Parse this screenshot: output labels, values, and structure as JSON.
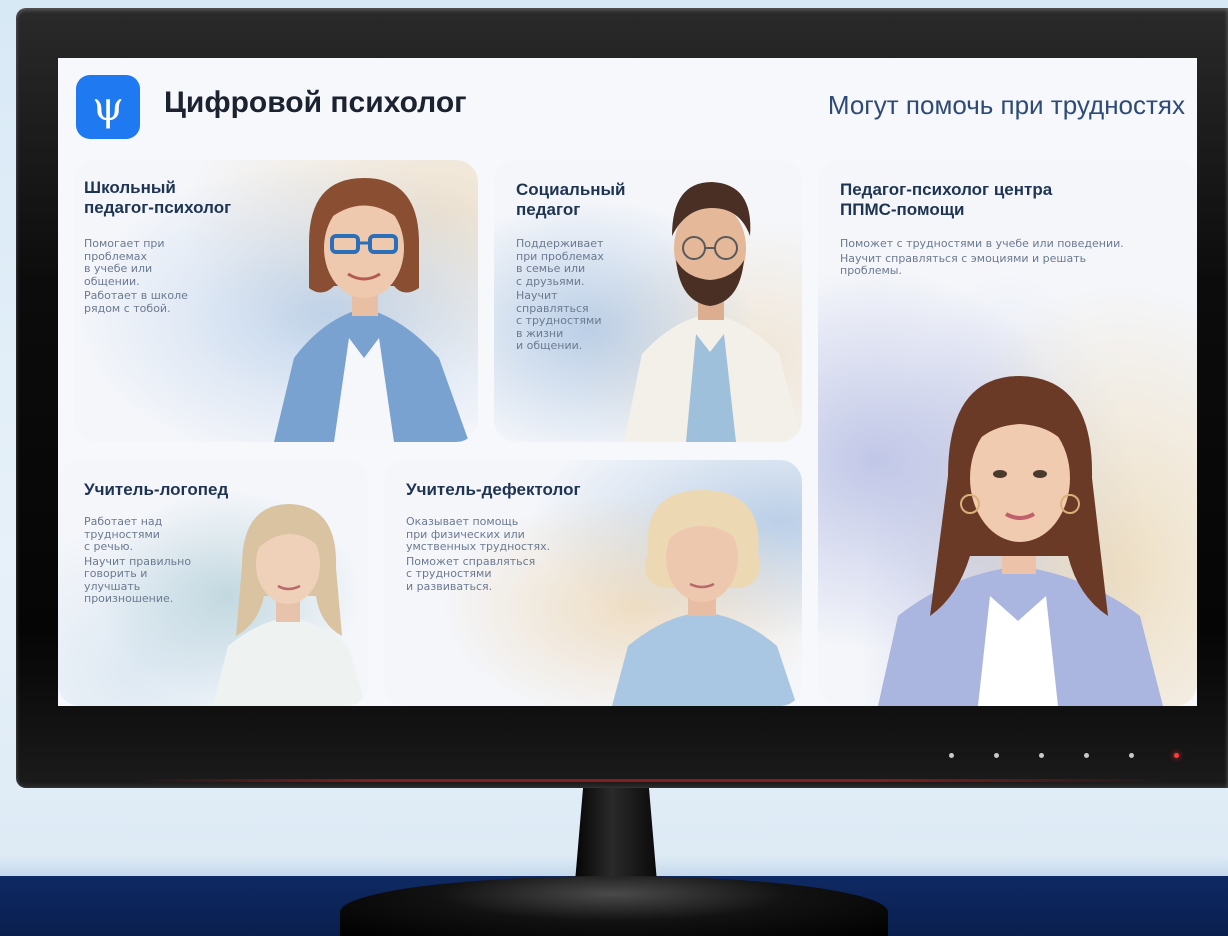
{
  "app": {
    "title": "Цифровой психолог",
    "subtitle": "Могут помочь при трудностях",
    "logo_icon": "psi-icon",
    "accent_color": "#1f79f0"
  },
  "cards": [
    {
      "title": "Школьный\nпедагог-психолог",
      "paragraphs": [
        "Помогает при\nпроблемах\nв учебе или\nобщении.",
        "Работает в школе\nрядом с тобой."
      ]
    },
    {
      "title": "Социальный\nпедагог",
      "paragraphs": [
        "Поддерживает\nпри проблемах\nв семье или\nс друзьями.",
        "Научит\nсправляться\nс трудностями\nв жизни\nи общении."
      ]
    },
    {
      "title": "Педагог-психолог центра\nППМС-помощи",
      "paragraphs": [
        "Поможет с трудностями в учебе или поведении.",
        "Научит справляться с эмоциями и решать\nпроблемы."
      ]
    },
    {
      "title": "Учитель-логопед",
      "paragraphs": [
        "Работает над\nтрудностями\nс речью.",
        "Научит правильно\nговорить и\nулучшать\nпроизношение."
      ]
    },
    {
      "title": "Учитель-дефектолог",
      "paragraphs": [
        "Оказывает помощь\nпри физических или\nумственных трудностях.",
        "Поможет справляться\nс трудностями\nи развиваться."
      ]
    }
  ]
}
